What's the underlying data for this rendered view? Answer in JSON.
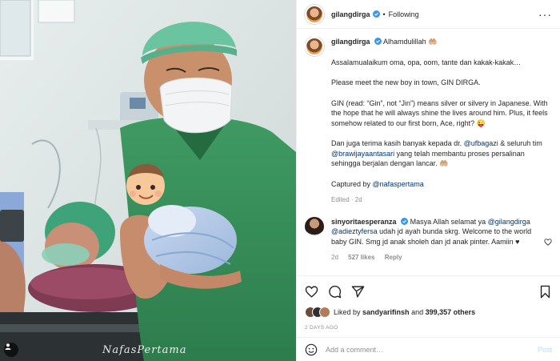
{
  "post": {
    "author": "gilangdirga",
    "follow_status": "Following",
    "separator": "•",
    "more_icon": "more-dots-icon",
    "watermark": "NafasPertama",
    "tag_icon": "person-tag-icon"
  },
  "caption": {
    "author": "gilangdirga",
    "first_line": "Alhamdulillah 🤲🏼",
    "paragraphs": [
      [
        "Assalamualaikum oma, opa, oom, tante dan kakak-kakak…"
      ],
      [
        "Please meet the new boy in town, GIN DIRGA."
      ],
      [
        "GIN (read: “Gin”, not “Jin”) means silver or silvery in Japanese. With the hope that he will always shine the lives around him. Plus, it feels somehow related to our first born, Ace, right? 😜"
      ]
    ],
    "thanks_pre": "Dan juga terima kasih banyak kepada dr. ",
    "thanks_mention1": "@ufbagazi",
    "thanks_mid": " & seluruh tim ",
    "thanks_mention2": "@brawijayaantasari",
    "thanks_post": " yang telah membantu proses persalinan sehingga berjalan dengan lancar. 🤲🏼",
    "captured_pre": "Captured by ",
    "captured_mention": "@nafaspertama",
    "edited": "Edited",
    "edited_age": "2d"
  },
  "comment": {
    "author": "sinyoritaesperanza",
    "text_pre": "Masya Allah selamat ya ",
    "mention1": "@gilangdirga",
    "mention2": "@adieztyfersa",
    "text_post": " udah jd ayah bunda skrg. Welcome to the world baby GIN. Smg jd anak sholeh dan jd anak pinter. Aamiin ♥",
    "age": "2d",
    "likes": "527 likes",
    "reply": "Reply"
  },
  "actions": {
    "like_icon": "heart-icon",
    "comment_icon": "comment-icon",
    "share_icon": "share-icon",
    "save_icon": "bookmark-icon",
    "liked_by_pre": "Liked by ",
    "liked_by_user": "sandyarifinsh",
    "liked_by_mid": " and ",
    "liked_by_count": "399,357 others",
    "post_age": "2 DAYS AGO"
  },
  "add_comment": {
    "emoji_icon": "emoji-icon",
    "placeholder": "Add a comment…",
    "post_label": "Post"
  },
  "colors": {
    "link": "#00376b",
    "verified": "#3897f0",
    "muted": "#8e8e8e",
    "post_button": "#b2dffc",
    "heart_red": "#ed4956"
  }
}
